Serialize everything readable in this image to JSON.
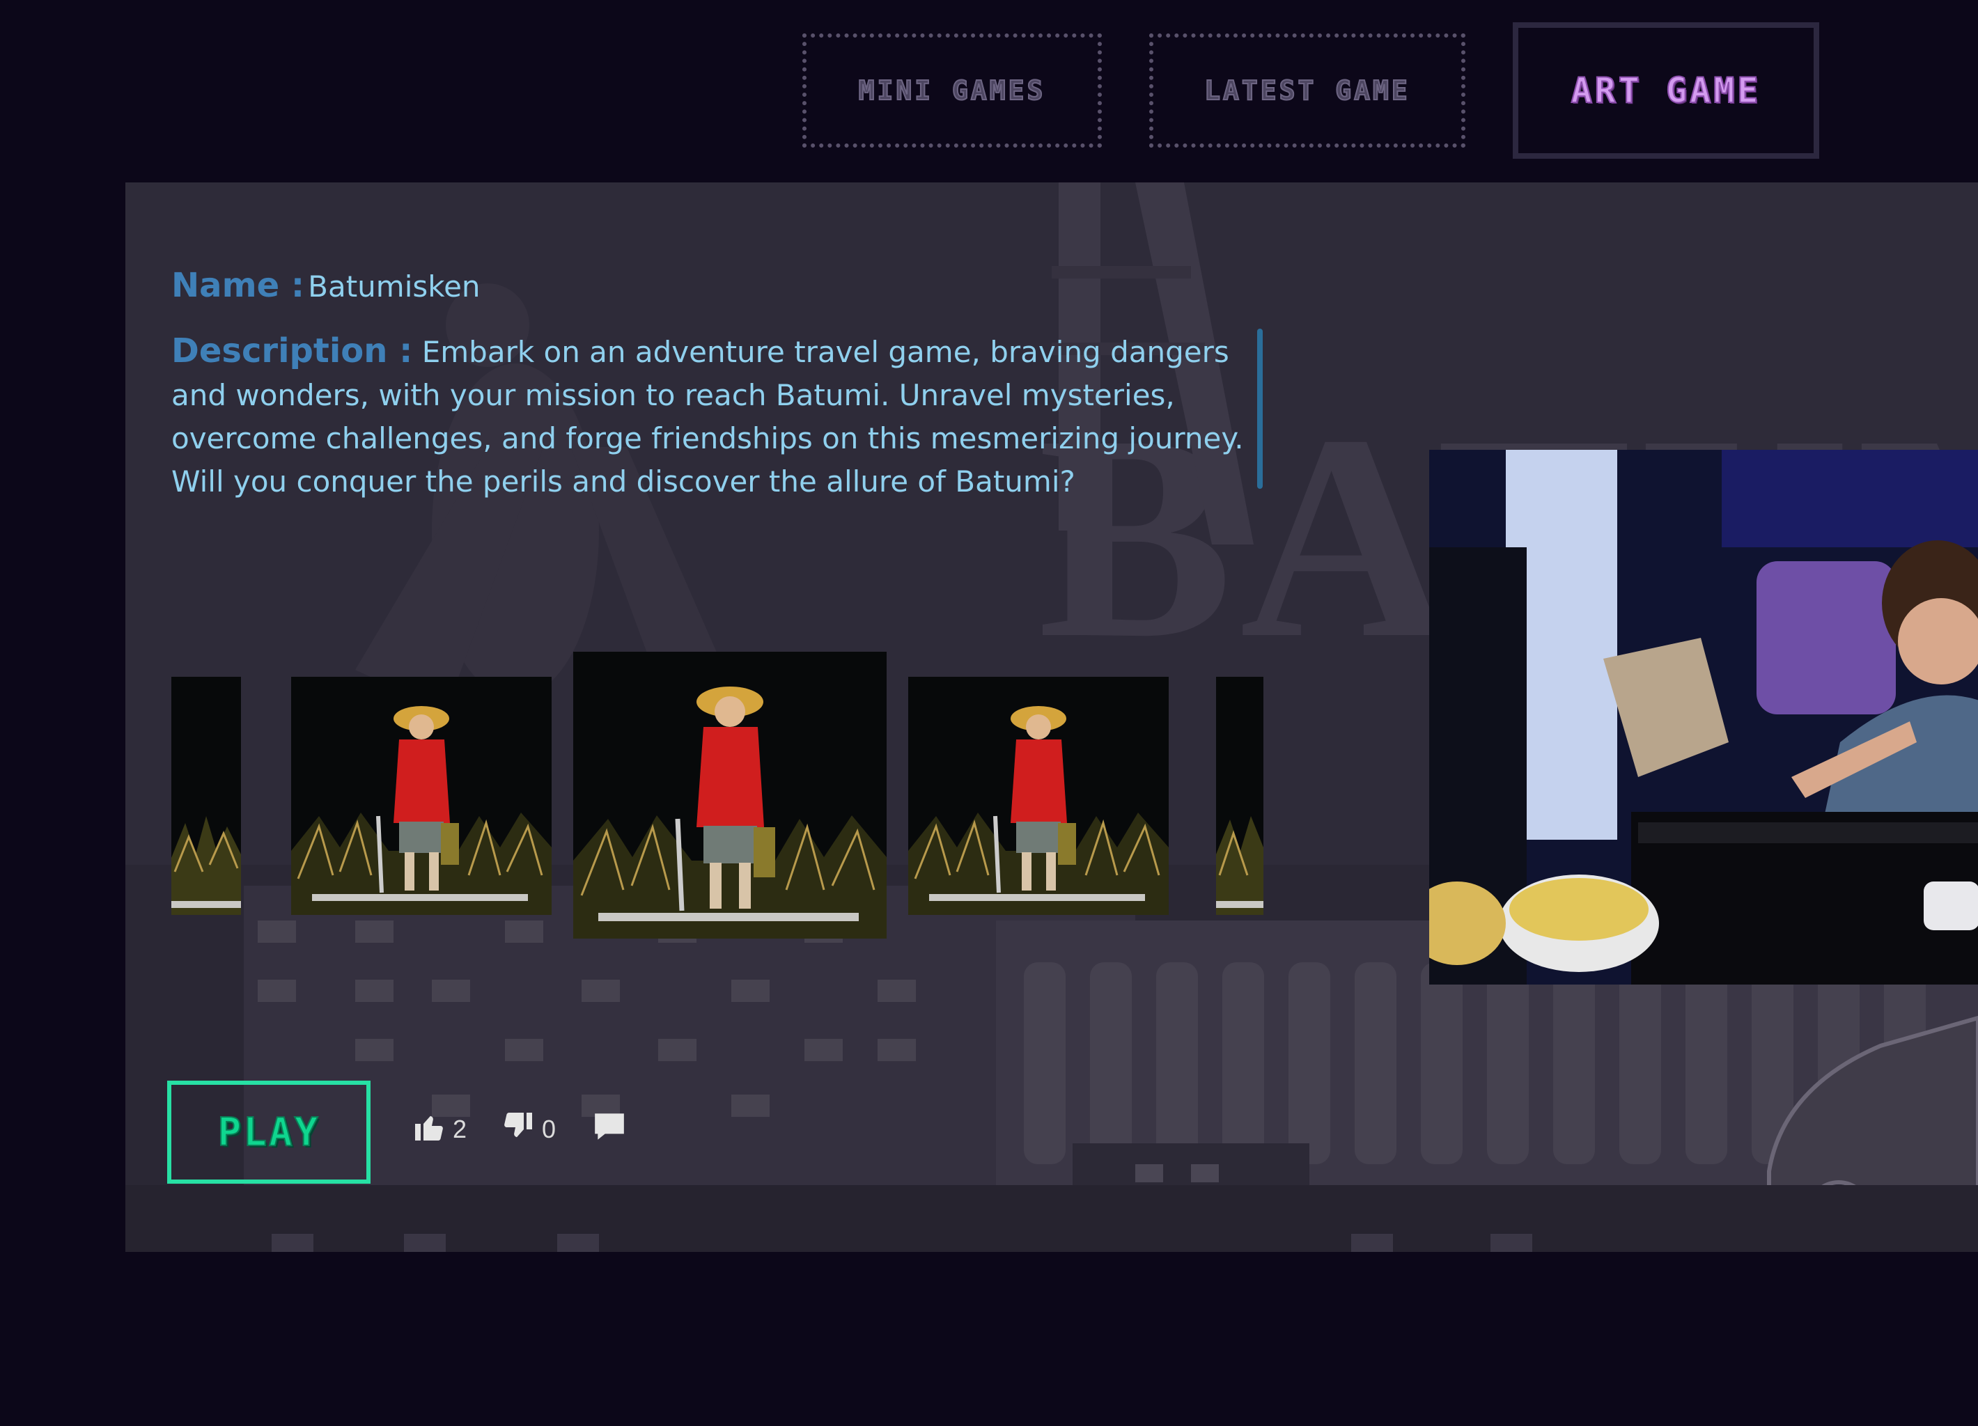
{
  "nav": {
    "tabs": [
      {
        "label": "MINI GAMES",
        "active": false
      },
      {
        "label": "LATEST GAME",
        "active": false
      },
      {
        "label": "ART GAME",
        "active": true
      }
    ]
  },
  "game": {
    "name_label": "Name :",
    "name": "Batumisken",
    "description_label": "Description :",
    "description": "Embark on an adventure travel game, braving dangers and wonders, with your mission to reach Batumi. Unravel mysteries, overcome challenges, and forge friendships on this mesmerizing journey. Will you conquer the perils and discover the allure of Batumi?",
    "background_title": "BATUMISK"
  },
  "actions": {
    "play_label": "PLAY",
    "likes": "2",
    "dislikes": "0",
    "like_icon": "thumbs-up-icon",
    "dislike_icon": "thumbs-down-icon",
    "comment_icon": "comment-icon"
  },
  "colors": {
    "page_background": "#0c0719",
    "panel_background": "#2e2b39",
    "accent_purple": "#d49bf0",
    "accent_green": "#27e0a4",
    "label_blue": "#3f80b8",
    "text_cyan": "#8fd0ee"
  }
}
